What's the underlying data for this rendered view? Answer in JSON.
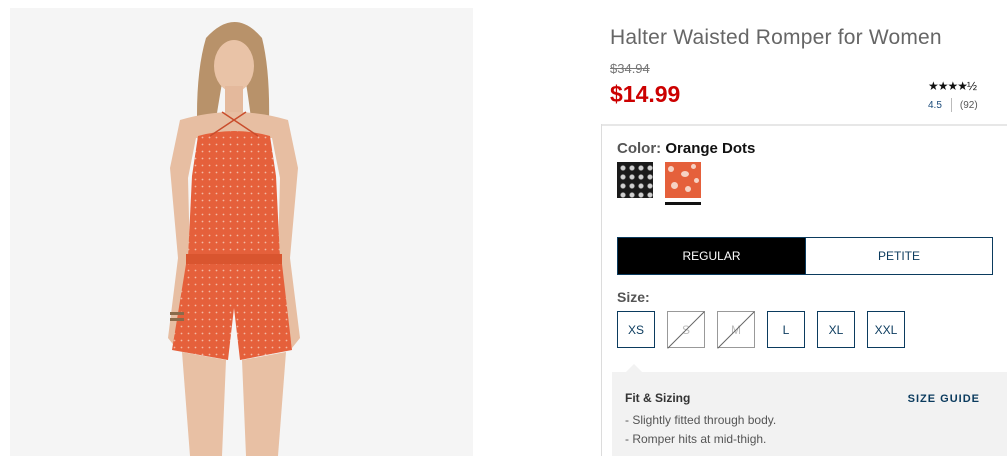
{
  "product": {
    "title": "Halter Waisted Romper for Women",
    "original_price": "$34.94",
    "sale_price": "$14.99",
    "rating": {
      "stars": "★★★★½",
      "score": "4.5",
      "reviews": "(92)"
    }
  },
  "color": {
    "label": "Color:",
    "selected": "Orange Dots",
    "swatches": [
      "black-dots",
      "orange-dots"
    ]
  },
  "fit_tabs": [
    "REGULAR",
    "PETITE"
  ],
  "size": {
    "label": "Size:",
    "options": [
      {
        "label": "XS",
        "available": true
      },
      {
        "label": "S",
        "available": false
      },
      {
        "label": "M",
        "available": false
      },
      {
        "label": "L",
        "available": true
      },
      {
        "label": "XL",
        "available": true
      },
      {
        "label": "XXL",
        "available": true
      }
    ]
  },
  "fit_sizing": {
    "title": "Fit & Sizing",
    "guide_link": "SIZE GUIDE",
    "bullets": [
      "Slightly fitted through body.",
      "Romper hits at mid-thigh."
    ]
  },
  "colors": {
    "sale_red": "#cc0000",
    "navy": "#0b3b5e",
    "romper_orange": "#e5603b"
  }
}
